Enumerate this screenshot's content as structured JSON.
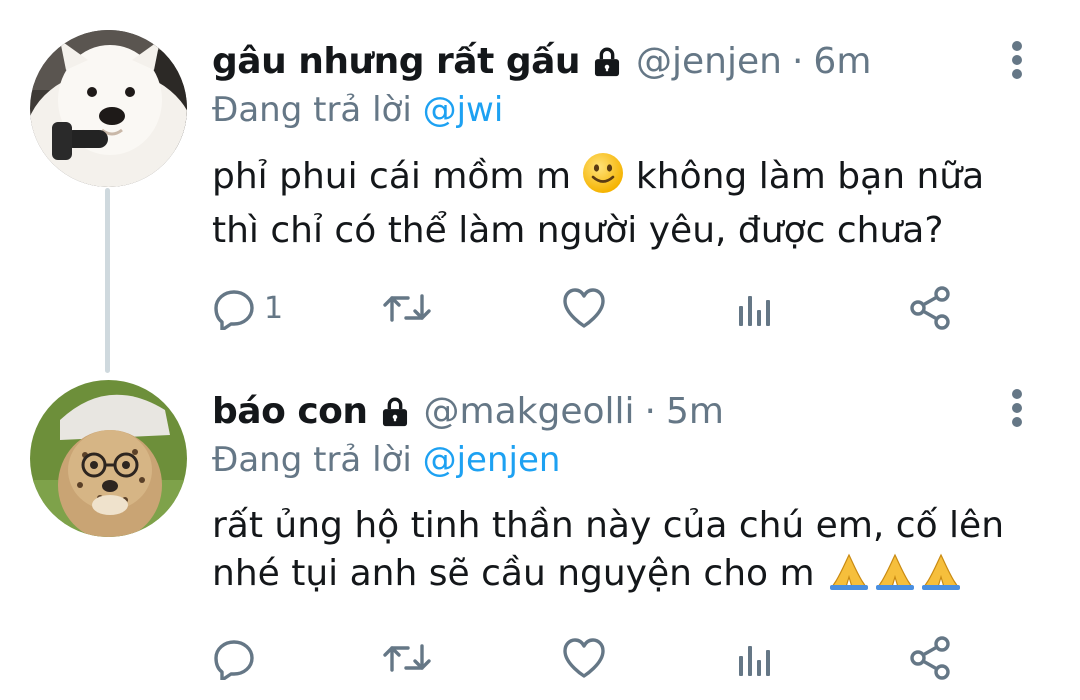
{
  "tweets": [
    {
      "display_name": "gâu nhưng rất gấu",
      "handle": "@jenjen",
      "separator": "·",
      "time": "6m",
      "replying_prefix": "Đang trả lời",
      "replying_to": "@jwi",
      "text_line1_a": "phỉ phui cái mồm m",
      "text_line1_b": "không làm bạn nữa",
      "text_line2": "thì chỉ có thể làm người yêu, được chưa?",
      "reply_count": "1",
      "avatar": "samoyed-dog-avatar"
    },
    {
      "display_name": "báo con",
      "handle": "@makgeolli",
      "separator": "·",
      "time": "5m",
      "replying_prefix": "Đang trả lời",
      "replying_to": "@jenjen",
      "text_line1": "rất ủng hộ tinh thần này của chú em, cố lên",
      "text_line2": "nhé tụi anh sẽ cầu nguyện cho m",
      "reply_count": "",
      "avatar": "cheetah-cub-avatar"
    }
  ],
  "icons": {
    "reply": "reply-icon",
    "retweet": "retweet-icon",
    "like": "like-icon",
    "analytics": "analytics-icon",
    "share": "share-icon",
    "lock": "lock-icon",
    "more": "more-vertical-icon",
    "smile_emoji": "slightly-smiling-face-emoji",
    "pray_emoji": "folded-hands-emoji"
  },
  "colors": {
    "text": "#14171a",
    "muted": "#657786",
    "link": "#1da1f2",
    "thread_line": "#cfd9de"
  }
}
